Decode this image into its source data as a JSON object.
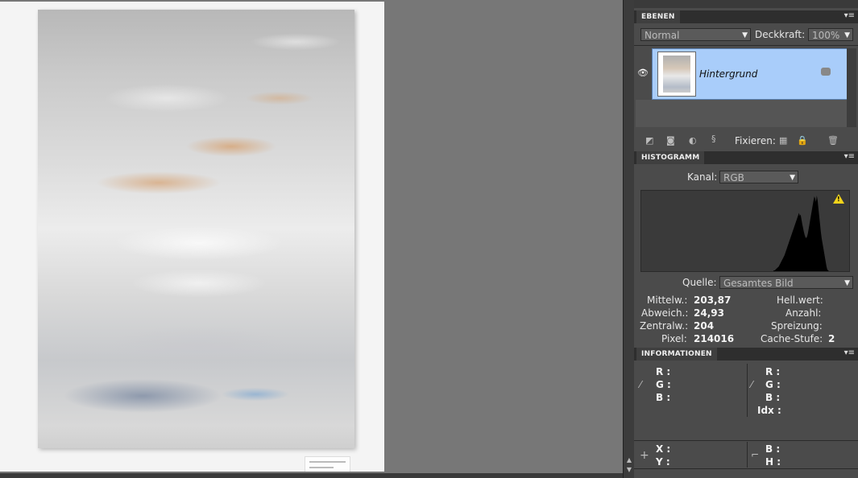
{
  "layers_panel": {
    "tab_title": "EBENEN",
    "blend_mode": "Normal",
    "opacity_label": "Deckkraft:",
    "opacity_value": "100%",
    "layer_name": "Hintergrund",
    "lock_label": "Fixieren:"
  },
  "histogram_panel": {
    "tab_title": "HISTOGRAMM",
    "channel_label": "Kanal:",
    "channel_value": "RGB",
    "source_label": "Quelle:",
    "source_value": "Gesamtes Bild",
    "stats": {
      "mean_label": "Mittelw.:",
      "mean_value": "203,87",
      "std_label": "Abweich.:",
      "std_value": "24,93",
      "median_label": "Zentralw.:",
      "median_value": "204",
      "pixels_label": "Pixel:",
      "pixels_value": "214016",
      "level_label": "Hell.wert:",
      "level_value": "",
      "count_label": "Anzahl:",
      "count_value": "",
      "percentile_label": "Spreizung:",
      "percentile_value": "",
      "cache_label": "Cache-Stufe:",
      "cache_value": "2"
    },
    "histogram_values": [
      0,
      0,
      0,
      0,
      0,
      0,
      0,
      0,
      0,
      0,
      0,
      0,
      0,
      0,
      0,
      0,
      0,
      0,
      0,
      0,
      0,
      0,
      0,
      0,
      0,
      0,
      0,
      0,
      0,
      0,
      0,
      0,
      0,
      0,
      0,
      0,
      0,
      0,
      0,
      0,
      0,
      0,
      0,
      0,
      0,
      0,
      0,
      0,
      0,
      0,
      0,
      0,
      0,
      0,
      0,
      0,
      0,
      0,
      0,
      0,
      0,
      0,
      0,
      0,
      0,
      0,
      0,
      0,
      0,
      0,
      0,
      0,
      0,
      0,
      0,
      0,
      0,
      0,
      0,
      0,
      0,
      0,
      0,
      0,
      0,
      0,
      0,
      0,
      0,
      0,
      0,
      0,
      0,
      0,
      0,
      0,
      0,
      0,
      0,
      0,
      0,
      0,
      0,
      0,
      0,
      0,
      0,
      0,
      0,
      0,
      0,
      0,
      0,
      0,
      0,
      0,
      0,
      0,
      0,
      0,
      0,
      0,
      0,
      0,
      0,
      0,
      0,
      0,
      0,
      0,
      0,
      0,
      0,
      0,
      0,
      0,
      0,
      0,
      0,
      0,
      0,
      0,
      0,
      0,
      0,
      0,
      0,
      0,
      0,
      0,
      0,
      0,
      0,
      0,
      0,
      0,
      0,
      0,
      0,
      0,
      0,
      0,
      0,
      0,
      1,
      1,
      2,
      3,
      4,
      5,
      6,
      8,
      10,
      12,
      14,
      16,
      18,
      20,
      23,
      26,
      29,
      32,
      35,
      38,
      41,
      44,
      47,
      50,
      53,
      56,
      59,
      62,
      65,
      68,
      71,
      74,
      70,
      72,
      66,
      60,
      55,
      50,
      46,
      43,
      42,
      44,
      48,
      54,
      60,
      66,
      72,
      78,
      84,
      90,
      95,
      92,
      88,
      96,
      90,
      80,
      70,
      60,
      50,
      42,
      36,
      30,
      24,
      18,
      12,
      6,
      2,
      1,
      0,
      0,
      0,
      0,
      0,
      0,
      0,
      0,
      0,
      0,
      0,
      0,
      0,
      0,
      0,
      0,
      0,
      0,
      0,
      0,
      0,
      0,
      0,
      0,
      0
    ]
  },
  "info_panel": {
    "tab_title": "INFORMATIONEN",
    "left": {
      "r": "R :",
      "g": "G :",
      "b": "B :"
    },
    "right": {
      "r": "R :",
      "g": "G :",
      "b": "B :",
      "idx": "Idx :"
    },
    "x": "X :",
    "y": "Y :",
    "w": "B :",
    "h": "H :"
  },
  "colors": {
    "layer_selected": "#a9cdfa",
    "panel_bg": "#4b4b4b",
    "warning": "#f2d31b"
  }
}
